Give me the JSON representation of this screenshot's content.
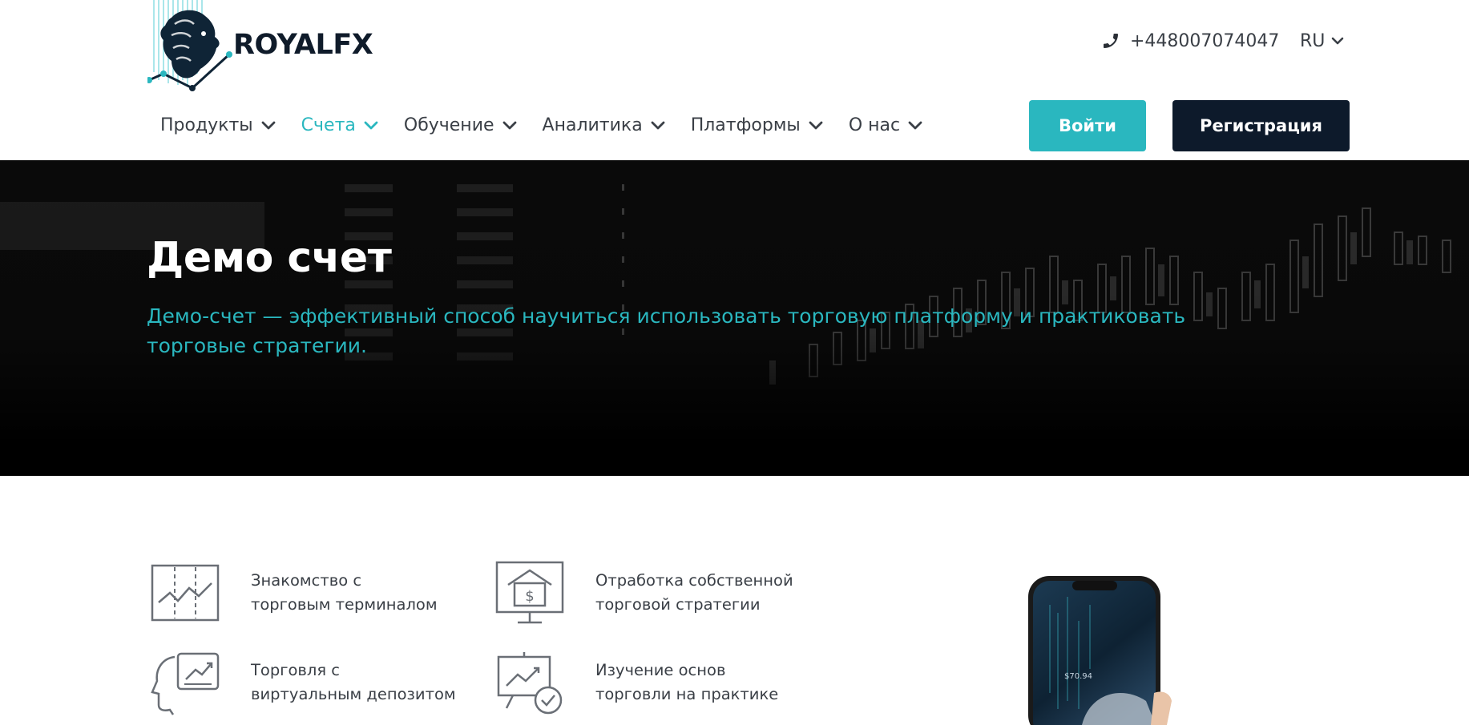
{
  "header": {
    "logo_text": "ROYALFX",
    "phone_number": "+448007074047",
    "language": "RU",
    "nav": [
      {
        "label": "Продукты",
        "active": false
      },
      {
        "label": "Счета",
        "active": true
      },
      {
        "label": "Обучение",
        "active": false
      },
      {
        "label": "Аналитика",
        "active": false
      },
      {
        "label": "Платформы",
        "active": false
      },
      {
        "label": "О нас",
        "active": false
      }
    ],
    "login_label": "Войти",
    "register_label": "Регистрация"
  },
  "hero": {
    "title": "Демо счет",
    "subtitle": "Демо-счет — эффективный способ научиться использовать торговую платформу и практиковать торговые стратегии."
  },
  "features": [
    {
      "text_line1": "Знакомство с",
      "text_line2": "торговым терминалом",
      "icon": "chart-board-icon"
    },
    {
      "text_line1": "Отработка собственной",
      "text_line2": "торговой стратегии",
      "icon": "dollar-house-monitor-icon"
    },
    {
      "text_line1": "Торговля с",
      "text_line2": "виртуальным депозитом",
      "icon": "head-chart-icon"
    },
    {
      "text_line1": "Изучение основ",
      "text_line2": "торговли на практике",
      "icon": "presentation-check-icon"
    }
  ],
  "colors": {
    "accent": "#2ab7bf",
    "dark": "#0d1a2b",
    "text": "#3a3f46"
  }
}
